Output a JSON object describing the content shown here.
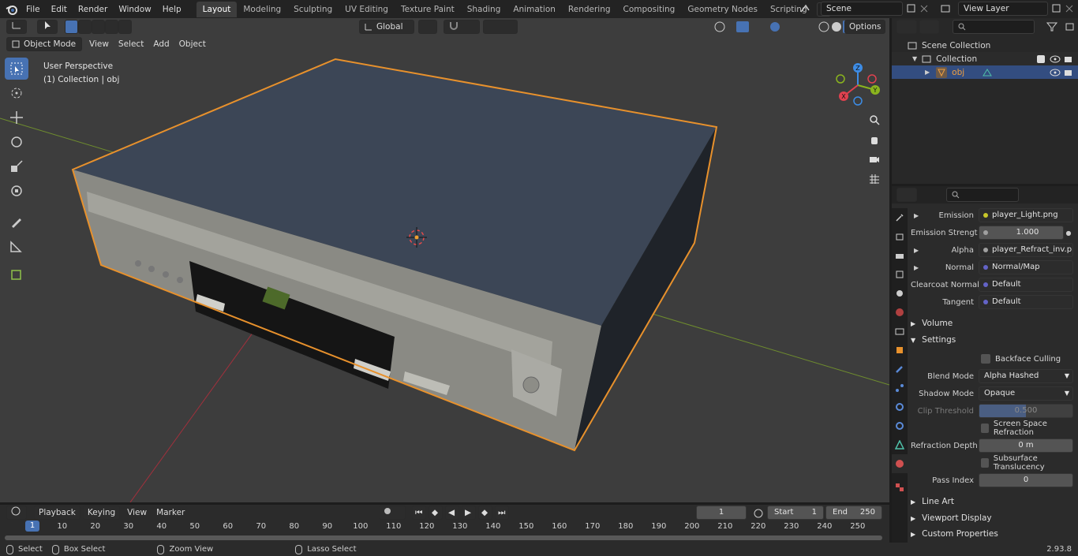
{
  "menu": [
    "File",
    "Edit",
    "Render",
    "Window",
    "Help"
  ],
  "workspaces": [
    "Layout",
    "Modeling",
    "Sculpting",
    "UV Editing",
    "Texture Paint",
    "Shading",
    "Animation",
    "Rendering",
    "Compositing",
    "Geometry Nodes",
    "Scripting"
  ],
  "active_workspace": "Layout",
  "plus_label": "+",
  "scene": {
    "name": "Scene",
    "view_layer": "View Layer"
  },
  "viewport": {
    "mode": "Object Mode",
    "menus": [
      "View",
      "Select",
      "Add",
      "Object"
    ],
    "transform_orientation": "Global",
    "options_label": "Options",
    "info_line1": "User Perspective",
    "info_line2": "(1) Collection | obj",
    "gizmo_axes": {
      "x": "X",
      "y": "Y",
      "z": "Z"
    }
  },
  "outliner": {
    "scene_collection": "Scene Collection",
    "collection": "Collection",
    "object": "obj"
  },
  "properties": {
    "emission": {
      "label": "Emission",
      "value": "player_Light.png"
    },
    "emission_strength": {
      "label": "Emission Strengt",
      "value": "1.000"
    },
    "alpha": {
      "label": "Alpha",
      "value": "player_Refract_inv.p..."
    },
    "normal": {
      "label": "Normal",
      "value": "Normal/Map"
    },
    "clearcoat_normal": {
      "label": "Clearcoat Normal",
      "value": "Default"
    },
    "tangent": {
      "label": "Tangent",
      "value": "Default"
    },
    "volume_section": "Volume",
    "settings_section": "Settings",
    "backface_culling": "Backface Culling",
    "blend_mode": {
      "label": "Blend Mode",
      "value": "Alpha Hashed"
    },
    "shadow_mode": {
      "label": "Shadow Mode",
      "value": "Opaque"
    },
    "clip_threshold": {
      "label": "Clip Threshold",
      "value": "0.500",
      "fraction": 0.5
    },
    "screen_space_refraction": "Screen Space Refraction",
    "refraction_depth": {
      "label": "Refraction Depth",
      "value": "0 m"
    },
    "subsurface_translucency": "Subsurface Translucency",
    "pass_index": {
      "label": "Pass Index",
      "value": "0"
    },
    "line_art_section": "Line Art",
    "viewport_display_section": "Viewport Display",
    "custom_properties_section": "Custom Properties"
  },
  "timeline": {
    "menus": [
      "Playback",
      "Keying",
      "View",
      "Marker"
    ],
    "current_frame": "1",
    "start_label": "Start",
    "start_value": "1",
    "end_label": "End",
    "end_value": "250",
    "ruler_current": "1",
    "ruler_ticks": [
      "10",
      "20",
      "30",
      "40",
      "50",
      "60",
      "70",
      "80",
      "90",
      "100",
      "110",
      "120",
      "130",
      "140",
      "150",
      "160",
      "170",
      "180",
      "190",
      "200",
      "210",
      "220",
      "230",
      "240",
      "250"
    ]
  },
  "statusbar": {
    "select": "Select",
    "box_select": "Box Select",
    "zoom_view": "Zoom View",
    "lasso_select": "Lasso Select",
    "version": "2.93.8"
  },
  "colors": {
    "accent": "#4772b3",
    "selection_outline": "#e8912c",
    "x_axis": "#e0414f",
    "y_axis": "#8ab41e",
    "z_axis": "#3d8ce5"
  }
}
